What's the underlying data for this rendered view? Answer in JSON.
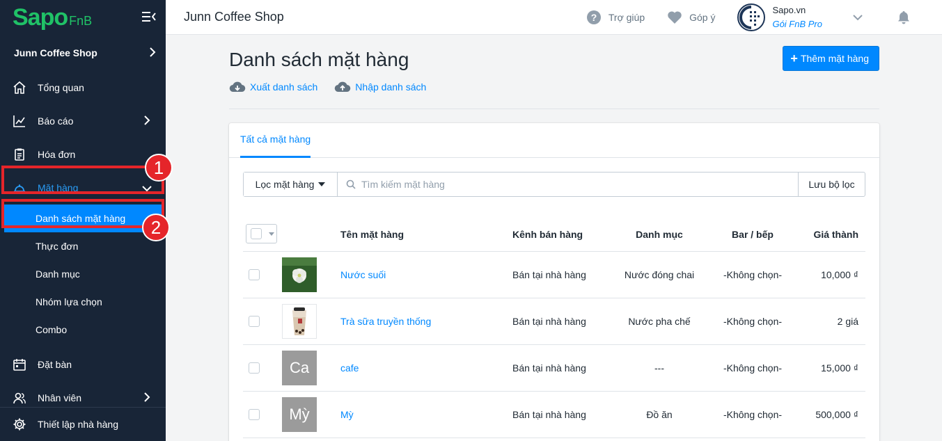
{
  "sidebar": {
    "logo_main": "Sapo",
    "logo_sub": "FnB",
    "shop_name": "Junn Coffee Shop",
    "items": [
      {
        "label": "Tổng quan"
      },
      {
        "label": "Báo cáo"
      },
      {
        "label": "Hóa đơn"
      },
      {
        "label": "Mặt hàng"
      },
      {
        "label": "Đặt bàn"
      },
      {
        "label": "Nhân viên"
      }
    ],
    "sub_items": [
      {
        "label": "Danh sách mặt hàng"
      },
      {
        "label": "Thực đơn"
      },
      {
        "label": "Danh mục"
      },
      {
        "label": "Nhóm lựa chọn"
      },
      {
        "label": "Combo"
      }
    ],
    "bottom_label": "Thiết lập nhà hàng",
    "badges": [
      "1",
      "2"
    ]
  },
  "topbar": {
    "title": "Junn Coffee Shop",
    "help": "Trợ giúp",
    "feedback": "Góp ý",
    "account_name": "Sapo.vn",
    "account_plan": "Gói FnB Pro"
  },
  "main": {
    "title": "Danh sách mặt hàng",
    "export": "Xuất danh sách",
    "import": "Nhập danh sách",
    "add_button": "Thêm mặt hàng",
    "tab": "Tất cả mặt hàng",
    "filter_button": "Lọc mặt hàng",
    "search_placeholder": "Tìm kiếm mặt hàng",
    "save_filter": "Lưu bộ lọc",
    "columns": [
      "Tên mặt hàng",
      "Kênh bán hàng",
      "Danh mục",
      "Bar / bếp",
      "Giá thành"
    ],
    "rows": [
      {
        "thumb": "",
        "name": "Nước suối",
        "channel": "Bán tại nhà hàng",
        "category": "Nước đóng chai",
        "bar": "-Không chọn-",
        "price": "10,000 ₫"
      },
      {
        "thumb": "",
        "name": "Trà sữa truyền thống",
        "channel": "Bán tại nhà hàng",
        "category": "Nước pha chế",
        "bar": "-Không chọn-",
        "price": "2 giá"
      },
      {
        "thumb": "Ca",
        "name": "cafe",
        "channel": "Bán tại nhà hàng",
        "category": "---",
        "bar": "-Không chọn-",
        "price": "15,000 ₫"
      },
      {
        "thumb": "Mỳ",
        "name": "Mỳ",
        "channel": "Bán tại nhà hàng",
        "category": "Đồ ăn",
        "bar": "-Không chọn-",
        "price": "500,000 ₫"
      }
    ]
  },
  "colors": {
    "sidebar_bg": "#182537",
    "accent": "#0088ff",
    "highlight": "#e5252a",
    "brand": "#20c267"
  }
}
